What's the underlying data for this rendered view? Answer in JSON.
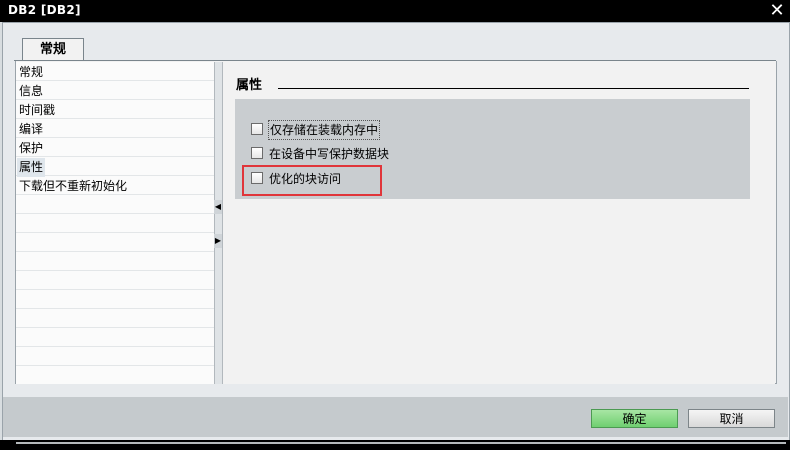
{
  "window": {
    "title": "DB2 [DB2]",
    "close_label": "✕"
  },
  "tab": {
    "label": "常规"
  },
  "nav": {
    "items": [
      "常规",
      "信息",
      "时间戳",
      "编译",
      "保护",
      "属性",
      "下载但不重新初始化"
    ],
    "selected": "属性"
  },
  "section": {
    "title": "属性"
  },
  "options": [
    {
      "label": "仅存储在装载内存中",
      "checked": false
    },
    {
      "label": "在设备中写保护数据块",
      "checked": false
    },
    {
      "label": "优化的块访问",
      "checked": false
    }
  ],
  "buttons": {
    "ok": "确定",
    "cancel": "取消"
  },
  "colors": {
    "highlight": "#e0353a",
    "ok_button": "#6fcf70",
    "title_bar": "#000000"
  },
  "icons": {
    "close": "close-icon",
    "splitter_left": "triangle-left-icon",
    "splitter_right": "triangle-right-icon"
  }
}
